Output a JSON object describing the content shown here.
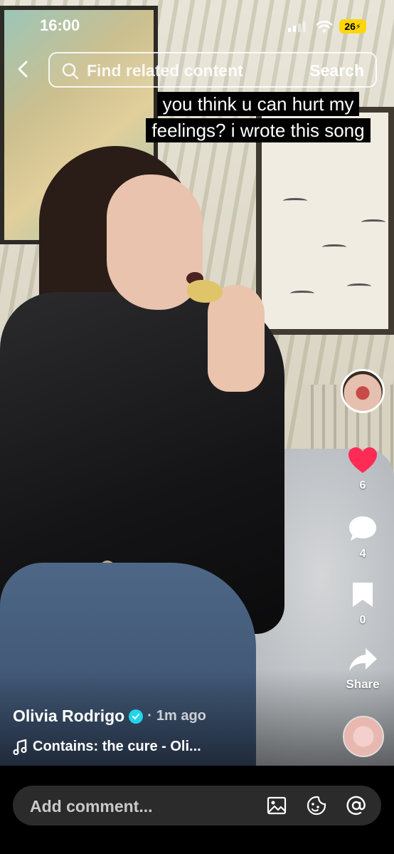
{
  "status_bar": {
    "time": "16:00",
    "battery": "26"
  },
  "search": {
    "placeholder": "Find related content",
    "button": "Search"
  },
  "caption": {
    "text": "you think u can hurt my feelings? i wrote this song"
  },
  "actions": {
    "likes": "6",
    "comments": "4",
    "saves": "0",
    "share_label": "Share"
  },
  "post": {
    "author": "Olivia Rodrigo",
    "time_ago": "1m ago",
    "sound": "Contains: the cure - Oli..."
  },
  "comment_bar": {
    "placeholder": "Add comment..."
  },
  "colors": {
    "like": "#fe2c55",
    "verified": "#20d5ec",
    "battery": "#ffd60a"
  }
}
